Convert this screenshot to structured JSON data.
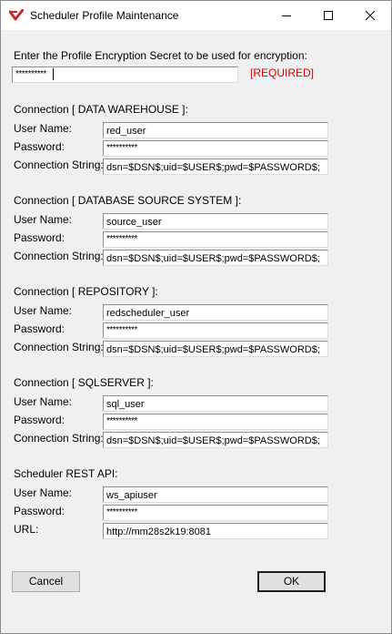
{
  "window": {
    "title": "Scheduler Profile Maintenance",
    "icons": {
      "app": "scheduler-app-icon",
      "minimize": "minimize-icon",
      "maximize": "maximize-icon",
      "close": "close-icon"
    }
  },
  "secret": {
    "prompt": "Enter the Profile Encryption Secret to be used for encryption:",
    "value": "**********",
    "required_label": "[REQUIRED]"
  },
  "labels": {
    "user_name": "User Name:",
    "password": "Password:",
    "connection_string": "Connection String:",
    "url": "URL:"
  },
  "connections": [
    {
      "header": "Connection [ DATA WAREHOUSE ]:",
      "user": "red_user",
      "password": "**********",
      "connection_string": "dsn=$DSN$;uid=$USER$;pwd=$PASSWORD$;"
    },
    {
      "header": "Connection [ DATABASE SOURCE SYSTEM ]:",
      "user": "source_user",
      "password": "**********",
      "connection_string": "dsn=$DSN$;uid=$USER$;pwd=$PASSWORD$;"
    },
    {
      "header": "Connection [ REPOSITORY ]:",
      "user": "redscheduler_user",
      "password": "**********",
      "connection_string": "dsn=$DSN$;uid=$USER$;pwd=$PASSWORD$;"
    },
    {
      "header": "Connection [ SQLSERVER ]:",
      "user": "sql_user",
      "password": "**********",
      "connection_string": "dsn=$DSN$;uid=$USER$;pwd=$PASSWORD$;"
    }
  ],
  "rest_api": {
    "header": "Scheduler REST API:",
    "user": "ws_apiuser",
    "password": "**********",
    "url": "http://mm28s2k19:8081"
  },
  "buttons": {
    "cancel": "Cancel",
    "ok": "OK"
  },
  "colors": {
    "required": "#d40000",
    "app_icon": "#c62828",
    "background": "#f0f0f0"
  }
}
